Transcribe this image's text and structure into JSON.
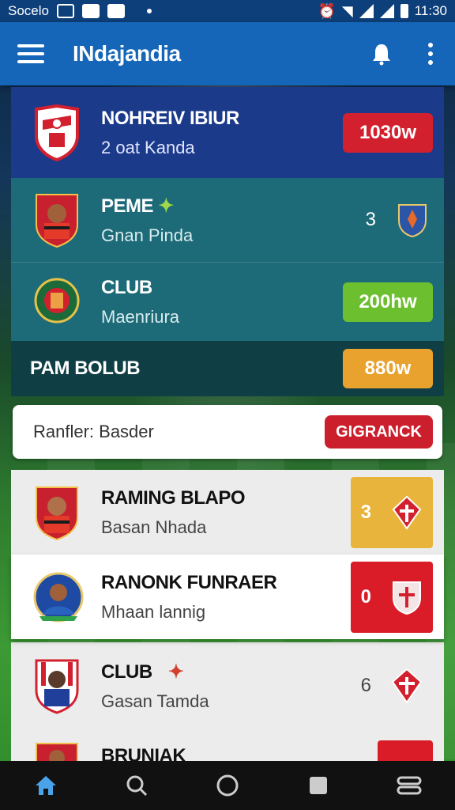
{
  "status_bar": {
    "carrier": "Socelo",
    "time": "11:30"
  },
  "app_bar": {
    "title": "INdajandia"
  },
  "featured": [
    {
      "name": "NOHREIV IBIUR",
      "sub": "2  oat Kanda",
      "badge": "1030w",
      "badge_color": "#d3202e"
    },
    {
      "name": "PEME",
      "sub": "Gnan Pinda",
      "score": "3"
    },
    {
      "name": "CLUB",
      "sub": "Maenriura",
      "badge": "200hw",
      "badge_color": "#6cbf2e"
    }
  ],
  "section": {
    "title": "PAM BOLUB",
    "badge": "880w",
    "badge_color": "#e9a22d"
  },
  "search": {
    "placeholder": "Ranfler: Basder",
    "button": "GIGRANCK"
  },
  "list": [
    {
      "name": "RAMING BLAPO",
      "sub": "Basan Nhada",
      "score": "3",
      "box_color": "#e8b43b"
    },
    {
      "name": "RANONK FUNRAER",
      "sub": "Mhaan lannig",
      "score": "0",
      "box_color": "#d91c27"
    },
    {
      "name": "CLUB",
      "sub": "Gasan Tamda",
      "score": "6"
    },
    {
      "name": "BRUNIAK",
      "sub": "",
      "score": ""
    }
  ],
  "colors": {
    "app_bar": "#1565b8",
    "accent_red": "#d3202e",
    "accent_green": "#6cbf2e",
    "accent_orange": "#e9a22d"
  }
}
